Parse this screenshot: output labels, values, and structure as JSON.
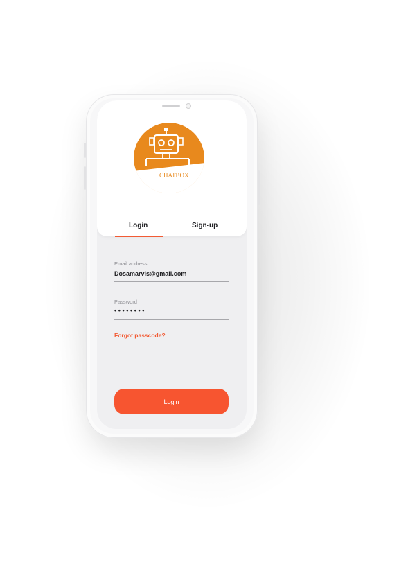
{
  "app": {
    "logo_text": "CHATBOX"
  },
  "tabs": [
    {
      "label": "Login",
      "active": true
    },
    {
      "label": "Sign-up",
      "active": false
    }
  ],
  "form": {
    "email_label": "Email address",
    "email_value": "Dosamarvis@gmail.com",
    "password_label": "Password",
    "password_value": "••••••••",
    "forgot_link": "Forgot passcode?",
    "submit_label": "Login"
  },
  "colors": {
    "accent": "#f75530",
    "logo_orange": "#e8891d",
    "screen_bg": "#efeff1"
  },
  "icons": [
    "robot-logo-icon"
  ]
}
